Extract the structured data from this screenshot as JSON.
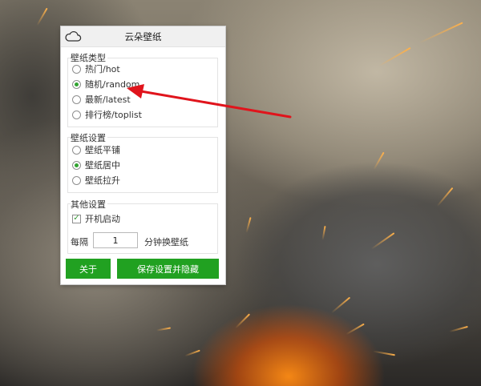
{
  "window": {
    "title": "云朵壁纸",
    "icon": "cloud-icon"
  },
  "wallpaper_type": {
    "label": "壁纸类型",
    "options": [
      {
        "label": "热门/hot",
        "checked": false
      },
      {
        "label": "随机/random",
        "checked": true
      },
      {
        "label": "最新/latest",
        "checked": false
      },
      {
        "label": "排行榜/toplist",
        "checked": false
      }
    ]
  },
  "wallpaper_settings": {
    "label": "壁纸设置",
    "options": [
      {
        "label": "壁纸平铺",
        "checked": false
      },
      {
        "label": "壁纸居中",
        "checked": true
      },
      {
        "label": "壁纸拉升",
        "checked": false
      }
    ]
  },
  "other_settings": {
    "label": "其他设置",
    "autostart_label": "开机启动",
    "autostart_checked": true,
    "check_mark": "✓"
  },
  "interval": {
    "prefix": "每隔",
    "value": "1",
    "suffix": "分钟换壁纸"
  },
  "buttons": {
    "about": "关于",
    "save_hide": "保存设置并隐藏"
  },
  "colors": {
    "accent_green": "#21a121",
    "arrow_red": "#e0141c"
  }
}
